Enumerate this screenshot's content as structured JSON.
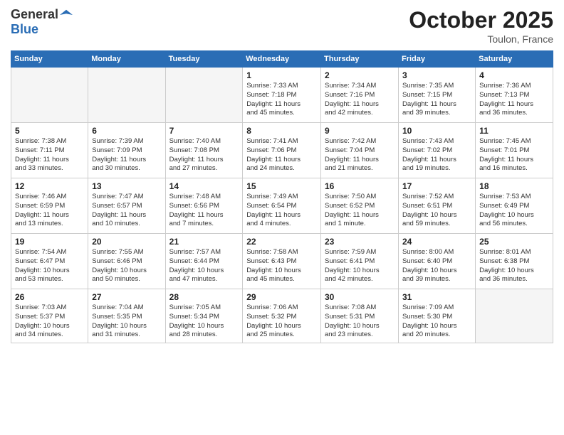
{
  "header": {
    "logo_line1": "General",
    "logo_line2": "Blue",
    "month": "October 2025",
    "location": "Toulon, France"
  },
  "weekdays": [
    "Sunday",
    "Monday",
    "Tuesday",
    "Wednesday",
    "Thursday",
    "Friday",
    "Saturday"
  ],
  "weeks": [
    [
      {
        "day": "",
        "info": ""
      },
      {
        "day": "",
        "info": ""
      },
      {
        "day": "",
        "info": ""
      },
      {
        "day": "1",
        "info": "Sunrise: 7:33 AM\nSunset: 7:18 PM\nDaylight: 11 hours\nand 45 minutes."
      },
      {
        "day": "2",
        "info": "Sunrise: 7:34 AM\nSunset: 7:16 PM\nDaylight: 11 hours\nand 42 minutes."
      },
      {
        "day": "3",
        "info": "Sunrise: 7:35 AM\nSunset: 7:15 PM\nDaylight: 11 hours\nand 39 minutes."
      },
      {
        "day": "4",
        "info": "Sunrise: 7:36 AM\nSunset: 7:13 PM\nDaylight: 11 hours\nand 36 minutes."
      }
    ],
    [
      {
        "day": "5",
        "info": "Sunrise: 7:38 AM\nSunset: 7:11 PM\nDaylight: 11 hours\nand 33 minutes."
      },
      {
        "day": "6",
        "info": "Sunrise: 7:39 AM\nSunset: 7:09 PM\nDaylight: 11 hours\nand 30 minutes."
      },
      {
        "day": "7",
        "info": "Sunrise: 7:40 AM\nSunset: 7:08 PM\nDaylight: 11 hours\nand 27 minutes."
      },
      {
        "day": "8",
        "info": "Sunrise: 7:41 AM\nSunset: 7:06 PM\nDaylight: 11 hours\nand 24 minutes."
      },
      {
        "day": "9",
        "info": "Sunrise: 7:42 AM\nSunset: 7:04 PM\nDaylight: 11 hours\nand 21 minutes."
      },
      {
        "day": "10",
        "info": "Sunrise: 7:43 AM\nSunset: 7:02 PM\nDaylight: 11 hours\nand 19 minutes."
      },
      {
        "day": "11",
        "info": "Sunrise: 7:45 AM\nSunset: 7:01 PM\nDaylight: 11 hours\nand 16 minutes."
      }
    ],
    [
      {
        "day": "12",
        "info": "Sunrise: 7:46 AM\nSunset: 6:59 PM\nDaylight: 11 hours\nand 13 minutes."
      },
      {
        "day": "13",
        "info": "Sunrise: 7:47 AM\nSunset: 6:57 PM\nDaylight: 11 hours\nand 10 minutes."
      },
      {
        "day": "14",
        "info": "Sunrise: 7:48 AM\nSunset: 6:56 PM\nDaylight: 11 hours\nand 7 minutes."
      },
      {
        "day": "15",
        "info": "Sunrise: 7:49 AM\nSunset: 6:54 PM\nDaylight: 11 hours\nand 4 minutes."
      },
      {
        "day": "16",
        "info": "Sunrise: 7:50 AM\nSunset: 6:52 PM\nDaylight: 11 hours\nand 1 minute."
      },
      {
        "day": "17",
        "info": "Sunrise: 7:52 AM\nSunset: 6:51 PM\nDaylight: 10 hours\nand 59 minutes."
      },
      {
        "day": "18",
        "info": "Sunrise: 7:53 AM\nSunset: 6:49 PM\nDaylight: 10 hours\nand 56 minutes."
      }
    ],
    [
      {
        "day": "19",
        "info": "Sunrise: 7:54 AM\nSunset: 6:47 PM\nDaylight: 10 hours\nand 53 minutes."
      },
      {
        "day": "20",
        "info": "Sunrise: 7:55 AM\nSunset: 6:46 PM\nDaylight: 10 hours\nand 50 minutes."
      },
      {
        "day": "21",
        "info": "Sunrise: 7:57 AM\nSunset: 6:44 PM\nDaylight: 10 hours\nand 47 minutes."
      },
      {
        "day": "22",
        "info": "Sunrise: 7:58 AM\nSunset: 6:43 PM\nDaylight: 10 hours\nand 45 minutes."
      },
      {
        "day": "23",
        "info": "Sunrise: 7:59 AM\nSunset: 6:41 PM\nDaylight: 10 hours\nand 42 minutes."
      },
      {
        "day": "24",
        "info": "Sunrise: 8:00 AM\nSunset: 6:40 PM\nDaylight: 10 hours\nand 39 minutes."
      },
      {
        "day": "25",
        "info": "Sunrise: 8:01 AM\nSunset: 6:38 PM\nDaylight: 10 hours\nand 36 minutes."
      }
    ],
    [
      {
        "day": "26",
        "info": "Sunrise: 7:03 AM\nSunset: 5:37 PM\nDaylight: 10 hours\nand 34 minutes."
      },
      {
        "day": "27",
        "info": "Sunrise: 7:04 AM\nSunset: 5:35 PM\nDaylight: 10 hours\nand 31 minutes."
      },
      {
        "day": "28",
        "info": "Sunrise: 7:05 AM\nSunset: 5:34 PM\nDaylight: 10 hours\nand 28 minutes."
      },
      {
        "day": "29",
        "info": "Sunrise: 7:06 AM\nSunset: 5:32 PM\nDaylight: 10 hours\nand 25 minutes."
      },
      {
        "day": "30",
        "info": "Sunrise: 7:08 AM\nSunset: 5:31 PM\nDaylight: 10 hours\nand 23 minutes."
      },
      {
        "day": "31",
        "info": "Sunrise: 7:09 AM\nSunset: 5:30 PM\nDaylight: 10 hours\nand 20 minutes."
      },
      {
        "day": "",
        "info": ""
      }
    ]
  ]
}
